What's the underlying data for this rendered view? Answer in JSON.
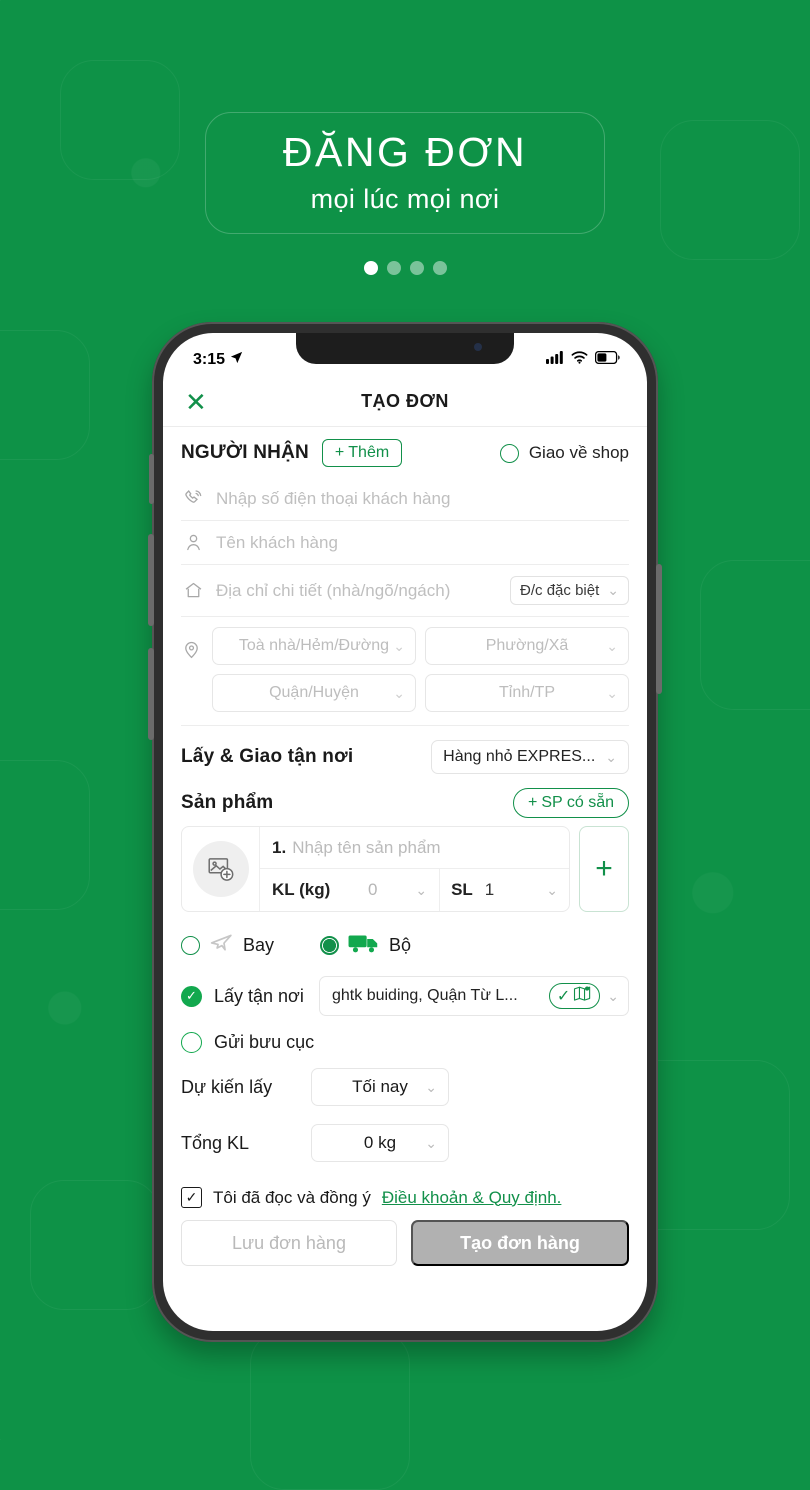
{
  "hero": {
    "title": "ĐĂNG ĐƠN",
    "subtitle": "mọi lúc mọi nơi",
    "dots_total": 4,
    "dots_active_index": 0
  },
  "colors": {
    "brand_green": "#0e9247",
    "accent_green": "#12904a",
    "check_green": "#12a84e",
    "disabled_grey": "#b1b1b1"
  },
  "phone": {
    "status_bar": {
      "time": "3:15",
      "location_icon": "location-arrow-icon",
      "signal_icon": "cellular-signal-icon",
      "wifi_icon": "wifi-icon",
      "battery_icon": "battery-icon"
    },
    "app_bar": {
      "close_icon": "close-icon",
      "title": "TẠO ĐƠN"
    },
    "receiver": {
      "section_label": "NGƯỜI NHẬN",
      "add_button": "Thêm",
      "add_icon": "plus-icon",
      "deliver_to_shop_label": "Giao về shop",
      "deliver_to_shop_selected": false,
      "phone_placeholder": "Nhập số điện thoại khách hàng",
      "phone_icon": "phone-icon",
      "name_placeholder": "Tên khách hàng",
      "name_icon": "user-icon",
      "address_placeholder": "Địa chỉ chi tiết (nhà/ngõ/ngách)",
      "address_icon": "home-icon",
      "special_address_label": "Đ/c đặc biệt",
      "location_icon": "map-pin-icon",
      "selects": [
        {
          "placeholder": "Toà nhà/Hẻm/Đường"
        },
        {
          "placeholder": "Phường/Xã"
        },
        {
          "placeholder": "Quận/Huyện"
        },
        {
          "placeholder": "Tỉnh/TP"
        }
      ]
    },
    "service": {
      "label": "Lấy & Giao tận nơi",
      "selected": "Hàng nhỏ EXPRES..."
    },
    "products": {
      "label": "Sản phẩm",
      "available_button": "SP có sẵn",
      "available_icon": "plus-icon",
      "thumb_icon": "image-add-icon",
      "items": [
        {
          "index": "1.",
          "name_placeholder": "Nhập tên sản phẩm",
          "weight_label": "KL (kg)",
          "weight_value": "0",
          "qty_label": "SL",
          "qty_value": "1"
        }
      ],
      "add_row_icon": "plus-icon"
    },
    "transport": {
      "air_label": "Bay",
      "air_icon": "airplane-icon",
      "air_selected": false,
      "road_label": "Bộ",
      "road_icon": "truck-icon",
      "road_selected": true
    },
    "pickup": {
      "at_place_label": "Lấy tận nơi",
      "at_place_selected": true,
      "check_icon": "check-icon",
      "address": "ghtk buiding, Quận Từ L...",
      "map_icon": "map-location-icon",
      "map_check_icon": "check-icon",
      "post_office_label": "Gửi bưu cục",
      "post_office_selected": false
    },
    "schedule": {
      "pickup_time_label": "Dự kiến lấy",
      "pickup_time_value": "Tối nay",
      "total_weight_label": "Tổng KL",
      "total_weight_value": "0 kg"
    },
    "terms": {
      "checked": true,
      "check_icon": "check-icon",
      "text": "Tôi đã đọc và đồng ý ",
      "link": "Điều khoản & Quy định."
    },
    "actions": {
      "save_label": "Lưu đơn hàng",
      "create_label": "Tạo đơn hàng"
    }
  }
}
